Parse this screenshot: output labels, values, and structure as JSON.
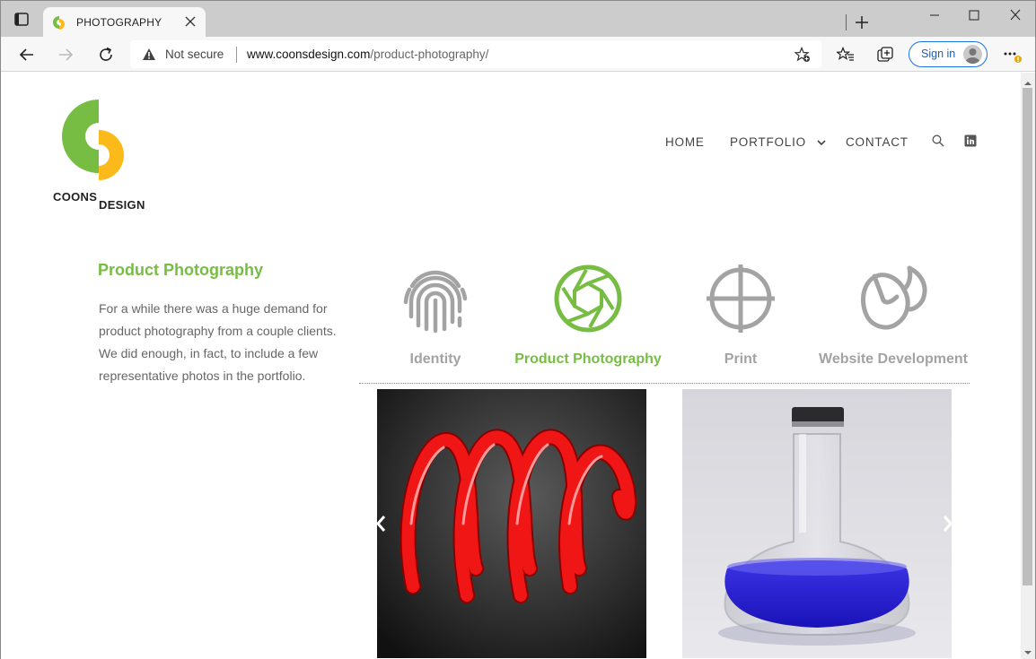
{
  "browser": {
    "tab_title": "PHOTOGRAPHY",
    "security_label": "Not secure",
    "url_host": "www.coonsdesign.com",
    "url_path": "/product-photography/",
    "signin_label": "Sign in"
  },
  "site": {
    "logo_word1": "COONS",
    "logo_word2": "DESIGN",
    "nav": {
      "home": "HOME",
      "portfolio": "PORTFOLIO",
      "contact": "CONTACT"
    }
  },
  "section": {
    "title": "Product Photography",
    "description": "For a while there was a huge demand for product photography from a couple clients. We did enough, in fact, to include a few representative photos in the portfolio."
  },
  "categories": [
    {
      "label": "Identity",
      "icon": "fingerprint-icon",
      "active": false
    },
    {
      "label": "Product Photography",
      "icon": "camera-aperture-icon",
      "active": true
    },
    {
      "label": "Print",
      "icon": "crosshair-icon",
      "active": false
    },
    {
      "label": "Website Development",
      "icon": "mouse-icon",
      "active": false
    }
  ],
  "colors": {
    "brand_green": "#77bd43",
    "brand_yellow": "#fbb91a",
    "inactive_gray": "#a3a3a3"
  },
  "gallery": {
    "photos": [
      "red-spiral-tube-photo",
      "blue-liquid-flask-photo"
    ]
  }
}
